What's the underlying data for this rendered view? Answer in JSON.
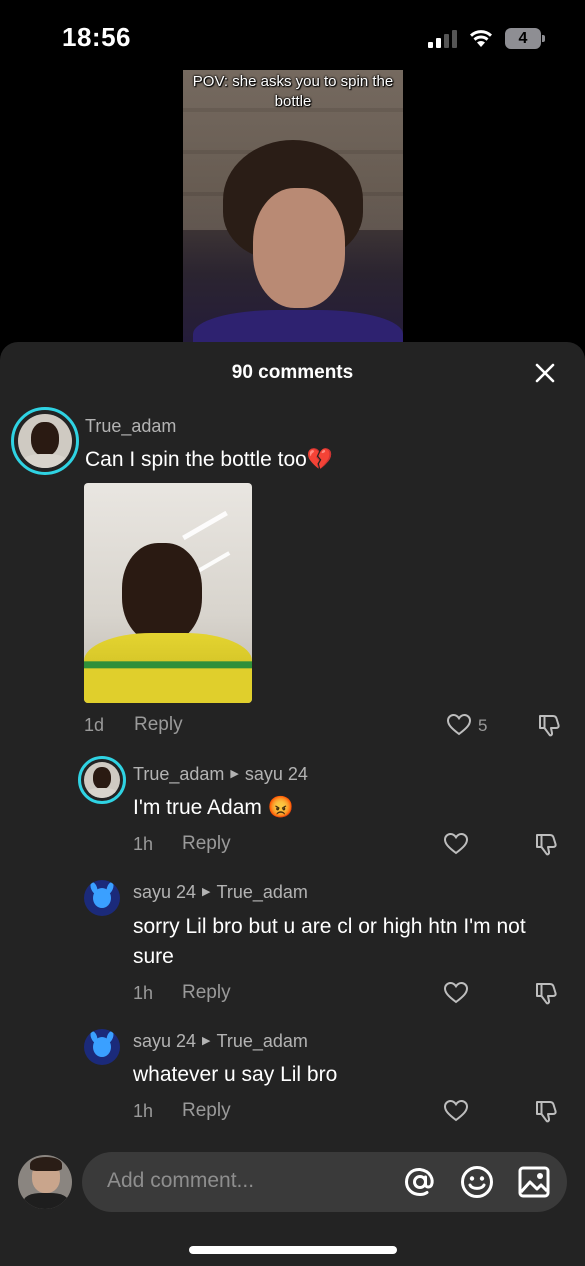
{
  "status_bar": {
    "time": "18:56",
    "battery": "4"
  },
  "video": {
    "caption": "POV: she asks you to spin the bottle"
  },
  "comments_sheet": {
    "title": "90 comments"
  },
  "comments": [
    {
      "username": "True_adam",
      "text": "Can I spin the bottle too",
      "emoji": "💔",
      "age": "1d",
      "reply_label": "Reply",
      "likes": "5"
    },
    {
      "username": "True_adam",
      "reply_to": "sayu 24",
      "text": "I'm true Adam",
      "emoji": "😡",
      "age": "1h",
      "reply_label": "Reply"
    },
    {
      "username": "sayu 24",
      "reply_to": "True_adam",
      "text": "sorry Lil bro but u are cl or high htn I'm not sure",
      "age": "1h",
      "reply_label": "Reply"
    },
    {
      "username": "sayu 24",
      "reply_to": "True_adam",
      "text": "whatever u say Lil bro",
      "age": "1h",
      "reply_label": "Reply"
    }
  ],
  "composer": {
    "placeholder": "Add comment..."
  },
  "colors": {
    "sheet_bg": "#232323",
    "ring": "#2fd3e3",
    "muted": "#9a9a9a"
  }
}
